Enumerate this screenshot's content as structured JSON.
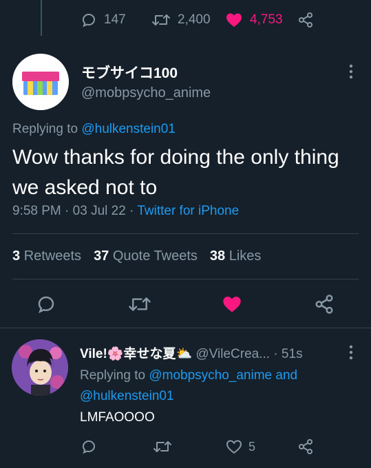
{
  "top_actions": {
    "replies": "147",
    "retweets": "2,400",
    "likes": "4,753"
  },
  "tweet": {
    "display_name": "モブサイコ100",
    "handle": "@mobpsycho_anime",
    "replying_prefix": "Replying to",
    "replying_to": "@hulkenstein01",
    "text": "Wow thanks for doing the only thing we asked not to",
    "time": "9:58 PM",
    "sep1": "·",
    "date": "03 Jul 22",
    "sep2": "·",
    "source": "Twitter for iPhone"
  },
  "stats": {
    "retweets_count": "3",
    "retweets_label": "Retweets",
    "quotes_count": "37",
    "quotes_label": "Quote Tweets",
    "likes_count": "38",
    "likes_label": "Likes"
  },
  "reply": {
    "display_name": "Vile!🌸幸せな夏⛅",
    "handle": "@VileCrea...",
    "time": "· 51s",
    "replying_prefix": "Replying to",
    "replying_to_1": "@mobpsycho_anime",
    "and": "and",
    "replying_to_2": "@hulkenstein01",
    "text": "LMFAOOOO",
    "likes": "5"
  },
  "colors": {
    "background": "#15202b",
    "like_pink": "#f91880",
    "link_blue": "#1d9bf0",
    "muted": "#8899a6"
  },
  "icons": [
    "reply-icon",
    "retweet-icon",
    "heart-filled-icon",
    "heart-outline-icon",
    "share-icon",
    "more-vertical-icon"
  ]
}
